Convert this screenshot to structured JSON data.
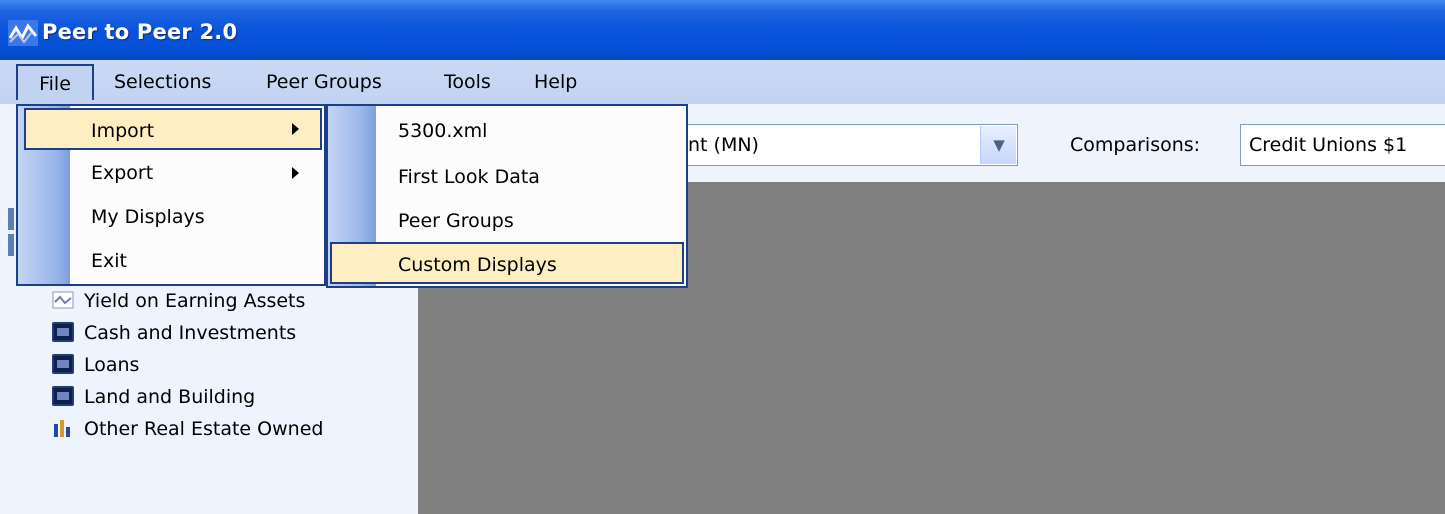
{
  "window": {
    "title": "Peer to Peer 2.0"
  },
  "menubar": {
    "items": [
      {
        "label": "File"
      },
      {
        "label": "Selections"
      },
      {
        "label": "Peer Groups"
      },
      {
        "label": "Tools"
      },
      {
        "label": "Help"
      }
    ]
  },
  "toolbar": {
    "credit_union_combo_value": "npoint (MN)",
    "comparisons_label": "Comparisons:",
    "comparisons_value": "Credit Unions $1"
  },
  "file_menu": {
    "items": [
      {
        "label": "Import",
        "has_submenu": true,
        "selected": true
      },
      {
        "label": "Export",
        "has_submenu": true
      },
      {
        "label": "My Displays"
      },
      {
        "label": "Exit"
      }
    ]
  },
  "import_submenu": {
    "items": [
      {
        "label": "5300.xml"
      },
      {
        "label": "First Look Data"
      },
      {
        "label": "Peer Groups"
      },
      {
        "label": "Custom Displays",
        "selected": true
      }
    ]
  },
  "tree": {
    "items": [
      {
        "label": "Yield on Earning Assets",
        "icon": "line-chart-icon"
      },
      {
        "label": "Cash and Investments",
        "icon": "folder-icon"
      },
      {
        "label": "Loans",
        "icon": "folder-icon"
      },
      {
        "label": "Land and Building",
        "icon": "folder-icon"
      },
      {
        "label": "Other Real Estate Owned",
        "icon": "bar-chart-icon"
      }
    ]
  },
  "colors": {
    "titlebar": "#0a55dc",
    "menu_highlight": "#ffeec2",
    "menu_border": "#1b3f8a",
    "content_bg": "#808080"
  }
}
